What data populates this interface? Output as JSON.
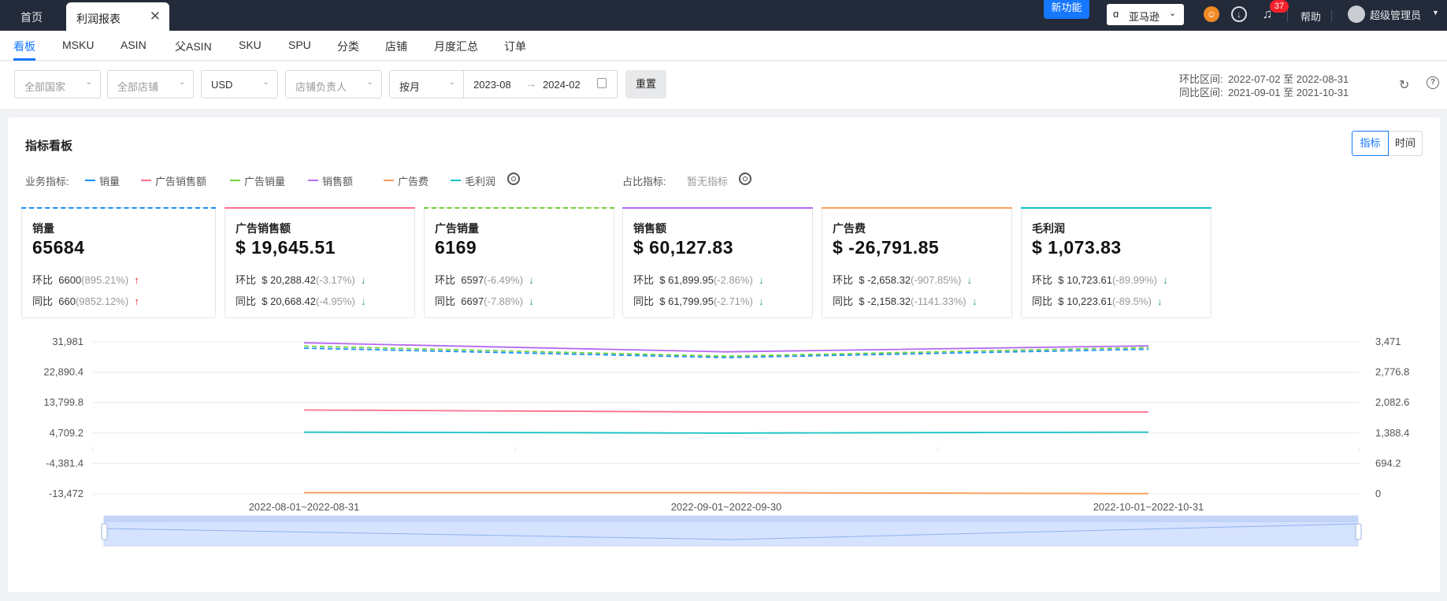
{
  "topbar": {
    "home_tab": "首页",
    "active_tab": "利润报表",
    "close_glyph": "✕",
    "new_feature": "新功能",
    "platform": "亚马逊",
    "notification_count": "37",
    "help": "帮助",
    "user": "超级管理员"
  },
  "subnav": [
    "看板",
    "MSKU",
    "ASIN",
    "父ASIN",
    "SKU",
    "SPU",
    "分类",
    "店铺",
    "月度汇总",
    "订单"
  ],
  "filters": {
    "country_placeholder": "全部国家",
    "store_placeholder": "全部店铺",
    "currency": "USD",
    "owner_placeholder": "店铺负责人",
    "period": "按月",
    "start": "2023-08",
    "end": "2024-02",
    "reset": "重置"
  },
  "compare": {
    "mom_label": "环比区间:",
    "mom_range": "2022-07-02 至 2022-08-31",
    "yoy_label": "同比区间:",
    "yoy_range": "2021-09-01 至 2021-10-31"
  },
  "panel": {
    "title": "指标看板",
    "toggle_metric": "指标",
    "toggle_time": "时间",
    "business_label": "业务指标:",
    "ratio_label": "占比指标:",
    "ratio_empty": "暂无指标"
  },
  "legend": [
    {
      "name": "销量",
      "color": "#1890ff"
    },
    {
      "name": "广告销售额",
      "color": "#ff6f8e"
    },
    {
      "name": "广告销量",
      "color": "#73d13d"
    },
    {
      "name": "销售额",
      "color": "#b66af5"
    },
    {
      "name": "广告费",
      "color": "#ff9c5a"
    },
    {
      "name": "毛利润",
      "color": "#13c2c2"
    }
  ],
  "cards": [
    {
      "title": "销量",
      "value": "65684",
      "color": "#1890ff",
      "dashed": true,
      "mom_label": "环比",
      "mom_value": "6600",
      "mom_pct": "(895.21%)",
      "mom_dir": "↑",
      "yoy_label": "同比",
      "yoy_value": "660",
      "yoy_pct": "(9852.12%)",
      "yoy_dir": "↑"
    },
    {
      "title": "广告销售额",
      "value": "$ 19,645.51",
      "color": "#ff6f8e",
      "dashed": false,
      "mom_label": "环比",
      "mom_value": "$ 20,288.42",
      "mom_pct": "(-3.17%)",
      "mom_dir": "↓",
      "yoy_label": "同比",
      "yoy_value": "$ 20,668.42",
      "yoy_pct": "(-4.95%)",
      "yoy_dir": "↓"
    },
    {
      "title": "广告销量",
      "value": "6169",
      "color": "#73d13d",
      "dashed": true,
      "mom_label": "环比",
      "mom_value": "6597",
      "mom_pct": "(-6.49%)",
      "mom_dir": "↓",
      "yoy_label": "同比",
      "yoy_value": "6697",
      "yoy_pct": "(-7.88%)",
      "yoy_dir": "↓"
    },
    {
      "title": "销售额",
      "value": "$ 60,127.83",
      "color": "#b66af5",
      "dashed": false,
      "mom_label": "环比",
      "mom_value": "$ 61,899.95",
      "mom_pct": "(-2.86%)",
      "mom_dir": "↓",
      "yoy_label": "同比",
      "yoy_value": "$ 61,799.95",
      "yoy_pct": "(-2.71%)",
      "yoy_dir": "↓"
    },
    {
      "title": "广告费",
      "value": "$ -26,791.85",
      "color": "#ffa35c",
      "dashed": false,
      "mom_label": "环比",
      "mom_value": "$ -2,658.32",
      "mom_pct": "(-907.85%)",
      "mom_dir": "↓",
      "yoy_label": "同比",
      "yoy_value": "$ -2,158.32",
      "yoy_pct": "(-1141.33%)",
      "yoy_dir": "↓"
    },
    {
      "title": "毛利润",
      "value": "$ 1,073.83",
      "color": "#13c2c2",
      "dashed": false,
      "mom_label": "环比",
      "mom_value": "$ 10,723.61",
      "mom_pct": "(-89.99%)",
      "mom_dir": "↓",
      "yoy_label": "同比",
      "yoy_value": "$ 10,223.61",
      "yoy_pct": "(-89.5%)",
      "yoy_dir": "↓"
    }
  ],
  "chart_data": {
    "type": "line",
    "categories": [
      "2022-08-01~2022-08-31",
      "2022-09-01~2022-09-30",
      "2022-10-01~2022-10-31"
    ],
    "y_left_ticks": [
      "31,981",
      "22,890.4",
      "13,799.8",
      "4,709.2",
      "-4,381.4",
      "-13,472"
    ],
    "y_left_range": [
      -13472,
      31981
    ],
    "y_right_ticks": [
      "3,471",
      "2,776.8",
      "2,082.6",
      "1,388.4",
      "694.2",
      "0"
    ],
    "y_right_range": [
      0,
      3471
    ],
    "grid": true,
    "series": [
      {
        "name": "销售额",
        "axis": "left",
        "style": "solid",
        "color": "#b66af5",
        "values": [
          31700,
          29000,
          30800
        ]
      },
      {
        "name": "销量",
        "axis": "left",
        "style": "dashed",
        "color": "#1890ff",
        "values": [
          30100,
          27300,
          29800
        ]
      },
      {
        "name": "广告销量",
        "axis": "left",
        "style": "dashed",
        "color": "#73d13d",
        "values": [
          30700,
          27700,
          30300
        ]
      },
      {
        "name": "广告销售额",
        "axis": "left",
        "style": "solid",
        "color": "#ff6f8e",
        "values": [
          11600,
          11000,
          11000
        ]
      },
      {
        "name": "毛利润",
        "axis": "left",
        "style": "solid",
        "color": "#13c2c2",
        "values": [
          5000,
          4700,
          5000
        ]
      },
      {
        "name": "广告费",
        "axis": "left",
        "style": "solid",
        "color": "#ff9c5a",
        "values": [
          -13100,
          -13100,
          -13400
        ]
      }
    ]
  }
}
